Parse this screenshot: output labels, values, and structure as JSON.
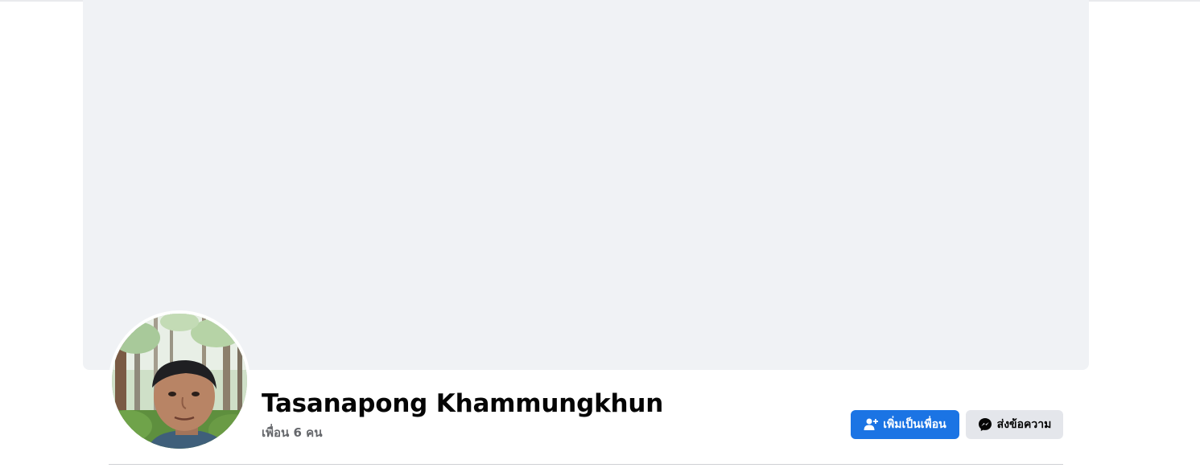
{
  "profile": {
    "name": "Tasanapong Khammungkhun",
    "friends_text": "เพื่อน 6 คน"
  },
  "actions": {
    "add_friend_label": "เพิ่มเป็นเพื่อน",
    "add_friend_icon": "add-friend-icon",
    "message_label": "ส่งข้อความ",
    "message_icon": "messenger-icon"
  },
  "colors": {
    "primary_button": "#1b74e4",
    "secondary_button": "#e4e6eb",
    "cover_background": "#f0f2f5",
    "secondary_text": "#65676b"
  }
}
